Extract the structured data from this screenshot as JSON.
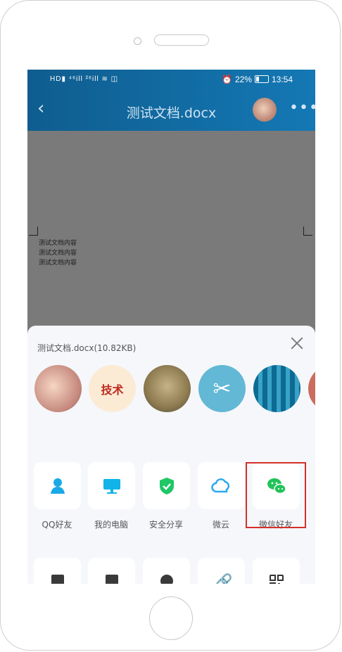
{
  "status_bar": {
    "left_text": "HD▮ ⁴⁶ill ²⁶ill ≋ ◫",
    "battery_percent": "22%",
    "time": "13:54"
  },
  "header": {
    "back_icon": "chevron-left-icon",
    "title": "测试文档.docx",
    "more_icon": "more-icon"
  },
  "document": {
    "lines": [
      "测试文档内容",
      "测试文档内容",
      "测试文档内容"
    ]
  },
  "share_sheet": {
    "file_label": "测试文档.docx(10.82KB)",
    "contacts": [
      {
        "name": "pig-avatar"
      },
      {
        "name": "技术"
      },
      {
        "name": "statue-avatar"
      },
      {
        "name": "scissors-avatar"
      },
      {
        "name": "blue-pattern-avatar"
      },
      {
        "name": "partial-avatar"
      }
    ],
    "share_targets": [
      {
        "label": "QQ好友",
        "icon": "qq-friend-icon",
        "color": "#1aa9e6"
      },
      {
        "label": "我的电脑",
        "icon": "computer-icon",
        "color": "#12b3e8"
      },
      {
        "label": "安全分享",
        "icon": "shield-check-icon",
        "color": "#1fc765"
      },
      {
        "label": "微云",
        "icon": "cloud-icon",
        "color": "#2aa8f0"
      },
      {
        "label": "微信好友",
        "icon": "wechat-icon",
        "color": "#23c35a"
      }
    ],
    "more_targets": [
      {
        "icon": "document-icon"
      },
      {
        "icon": "file-icon"
      },
      {
        "icon": "minus-circle-icon"
      },
      {
        "icon": "link-icon"
      },
      {
        "icon": "qr-code-icon"
      }
    ]
  }
}
